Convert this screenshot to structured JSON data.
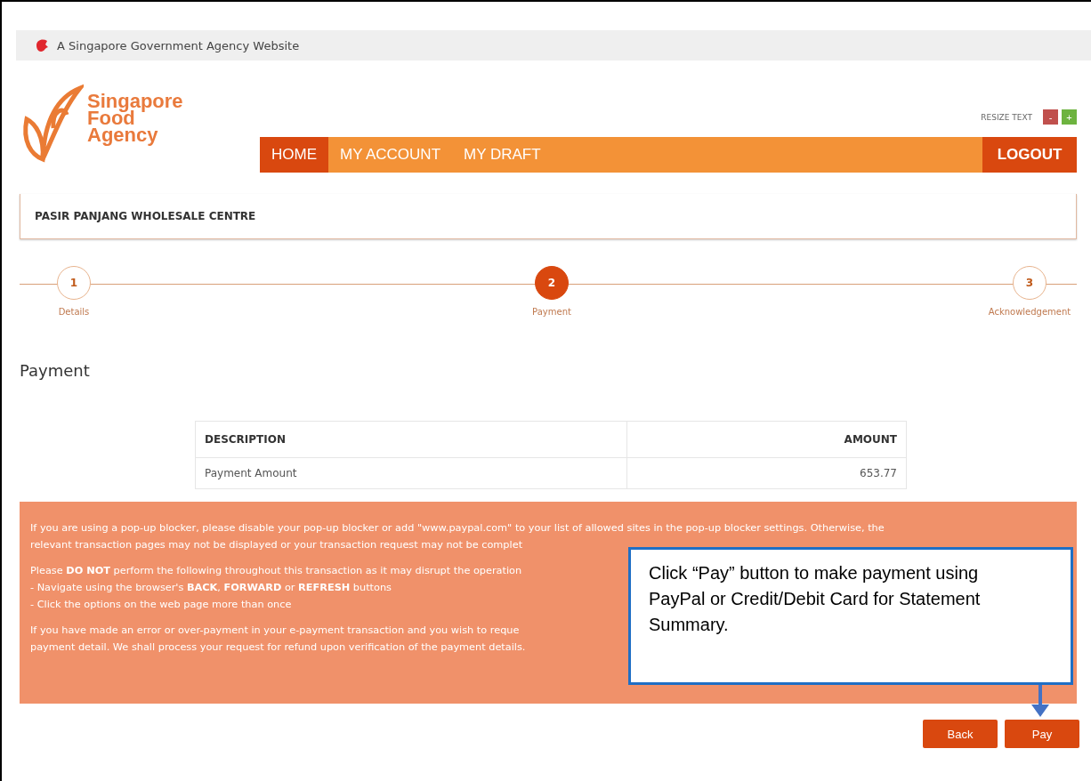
{
  "gov_bar": {
    "text": "A Singapore Government Agency Website"
  },
  "logo": {
    "lines": [
      "Singapore",
      "Food",
      "Agency"
    ]
  },
  "resize_text": {
    "label": "RESIZE TEXT",
    "decrease": "-",
    "increase": "+"
  },
  "nav": {
    "items": [
      {
        "label": "HOME",
        "selected": true
      },
      {
        "label": "MY ACCOUNT",
        "selected": false
      },
      {
        "label": "MY DRAFT",
        "selected": false
      }
    ],
    "logout": "LOGOUT"
  },
  "centre": {
    "title": "PASIR PANJANG WHOLESALE CENTRE"
  },
  "steps": [
    {
      "number": "1",
      "label": "Details",
      "selected": false
    },
    {
      "number": "2",
      "label": "Payment",
      "selected": true
    },
    {
      "number": "3",
      "label": "Acknowledgement",
      "selected": false
    }
  ],
  "heading": "Payment",
  "table": {
    "columns": [
      "DESCRIPTION",
      "AMOUNT"
    ],
    "rows": [
      [
        "Payment Amount",
        "653.77"
      ]
    ]
  },
  "notice": {
    "paragraphs": [
      [
        "If you are using a pop-up blocker, please disable your pop-up blocker or add \"www.paypal.com\" to your list of allowed sites in the pop-up blocker settings. Otherwise, the",
        "relevant transaction pages may not be displayed or your transaction request may not be complet"
      ],
      [
        "Please **DO NOT** perform the following throughout this transaction as it may disrupt the operation",
        "- Navigate using the browser's **BACK**, **FORWARD** or **REFRESH** buttons",
        "- Click the options on the web page more than once"
      ],
      [
        "If you have made an error or over-payment in your e-payment transaction and you wish to reque",
        "payment detail. We shall process your request for refund upon verification of the payment details."
      ]
    ]
  },
  "callout": {
    "text": "Click “Pay” button to make payment using PayPal or Credit/Debit Card for Statement Summary."
  },
  "buttons": [
    "Back",
    "Pay"
  ]
}
